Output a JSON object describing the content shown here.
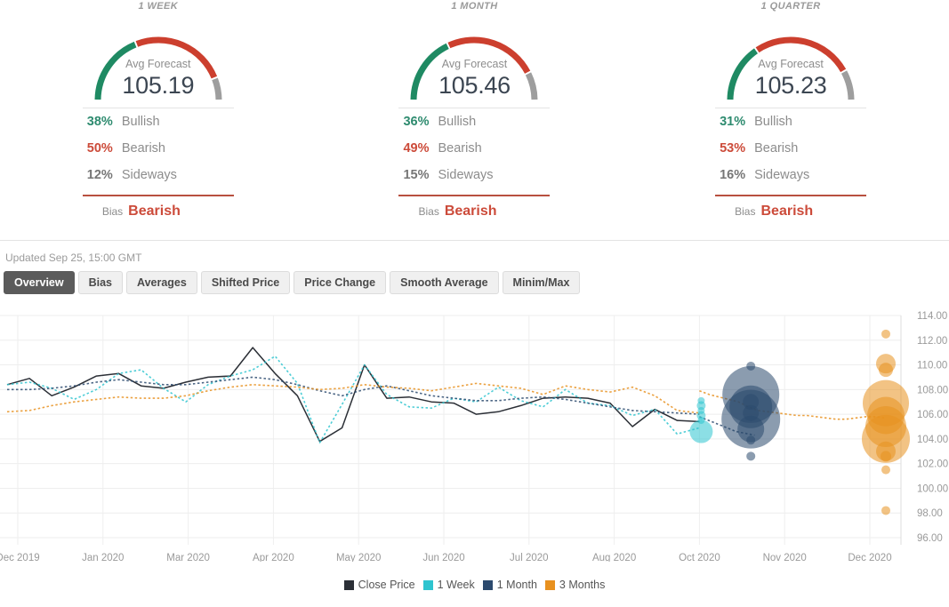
{
  "panels": [
    {
      "title": "1 WEEK",
      "gauge_label": "Avg Forecast",
      "value": "105.19",
      "bullish_pct": "38%",
      "bullish_label": "Bullish",
      "bearish_pct": "50%",
      "bearish_label": "Bearish",
      "sideways_pct": "12%",
      "sideways_label": "Sideways",
      "bias_label": "Bias",
      "bias_value": "Bearish",
      "gauge": {
        "bullish": 38,
        "bearish": 50,
        "sideways": 12
      }
    },
    {
      "title": "1 MONTH",
      "gauge_label": "Avg Forecast",
      "value": "105.46",
      "bullish_pct": "36%",
      "bullish_label": "Bullish",
      "bearish_pct": "49%",
      "bearish_label": "Bearish",
      "sideways_pct": "15%",
      "sideways_label": "Sideways",
      "bias_label": "Bias",
      "bias_value": "Bearish",
      "gauge": {
        "bullish": 36,
        "bearish": 49,
        "sideways": 15
      }
    },
    {
      "title": "1 QUARTER",
      "gauge_label": "Avg Forecast",
      "value": "105.23",
      "bullish_pct": "31%",
      "bullish_label": "Bullish",
      "bearish_pct": "53%",
      "bearish_label": "Bearish",
      "sideways_pct": "16%",
      "sideways_label": "Sideways",
      "bias_label": "Bias",
      "bias_value": "Bearish",
      "gauge": {
        "bullish": 31,
        "bearish": 53,
        "sideways": 16
      }
    }
  ],
  "updated": "Updated Sep 25, 15:00 GMT",
  "tabs": [
    {
      "label": "Overview",
      "active": true
    },
    {
      "label": "Bias",
      "active": false
    },
    {
      "label": "Averages",
      "active": false
    },
    {
      "label": "Shifted Price",
      "active": false
    },
    {
      "label": "Price Change",
      "active": false
    },
    {
      "label": "Smooth Average",
      "active": false
    },
    {
      "label": "Minim/Max",
      "active": false
    }
  ],
  "colors": {
    "bullish": "#1f8a63",
    "bearish": "#cc3f2e",
    "sideways": "#9e9e9e",
    "close_price": "#2b2f36",
    "one_week": "#2ec4cf",
    "one_month": "#2c4a6e",
    "three_months": "#e8911f",
    "grid": "#eeeeee"
  },
  "chart_data": {
    "type": "line",
    "title": "",
    "xlabel": "",
    "ylabel": "",
    "ylim": [
      96.0,
      114.0
    ],
    "y_ticks": [
      "96.00",
      "98.00",
      "100.00",
      "102.00",
      "104.00",
      "106.00",
      "108.00",
      "110.00",
      "112.00",
      "114.00"
    ],
    "x_ticks": [
      "Dec 2019",
      "Jan 2020",
      "Mar 2020",
      "Apr 2020",
      "May 2020",
      "Jun 2020",
      "Jul 2020",
      "Aug 2020",
      "Oct 2020",
      "Nov 2020",
      "Dec 2020"
    ],
    "grid": true,
    "legend_position": "bottom",
    "legend": [
      {
        "name": "Close Price",
        "color": "#2b2f36",
        "style": "solid"
      },
      {
        "name": "1 Week",
        "color": "#2ec4cf",
        "style": "dotted"
      },
      {
        "name": "1 Month",
        "color": "#2c4a6e",
        "style": "dotted"
      },
      {
        "name": "3 Months",
        "color": "#e8911f",
        "style": "dotted"
      }
    ],
    "series": [
      {
        "name": "Close Price",
        "color": "#2b2f36",
        "style": "solid",
        "values": [
          108.4,
          108.9,
          107.5,
          108.2,
          109.1,
          109.3,
          108.3,
          108.1,
          108.6,
          109.0,
          109.1,
          111.4,
          109.3,
          107.5,
          103.8,
          104.9,
          110.0,
          107.3,
          107.4,
          107.0,
          106.9,
          106.0,
          106.2,
          106.7,
          107.3,
          107.4,
          107.3,
          106.9,
          105.0,
          106.4,
          105.5,
          105.4
        ]
      },
      {
        "name": "1 Week",
        "color": "#2ec4cf",
        "style": "dotted",
        "values": [
          108.4,
          108.6,
          108.1,
          107.2,
          108.0,
          109.3,
          109.6,
          108.1,
          107.0,
          108.4,
          109.1,
          109.6,
          110.7,
          108.5,
          103.7,
          106.8,
          110.0,
          107.6,
          106.6,
          106.5,
          107.3,
          107.0,
          108.2,
          107.1,
          106.6,
          108.0,
          106.9,
          106.7,
          105.9,
          106.4,
          104.4,
          104.9
        ]
      },
      {
        "name": "1 Month",
        "color": "#2c4a6e",
        "style": "dotted",
        "values": [
          108.0,
          108.0,
          108.1,
          108.3,
          108.6,
          108.8,
          108.6,
          108.4,
          108.4,
          108.6,
          108.8,
          109.0,
          108.8,
          108.4,
          107.9,
          107.5,
          108.0,
          108.3,
          107.9,
          107.5,
          107.3,
          107.1,
          107.1,
          107.3,
          107.4,
          107.2,
          106.9,
          106.6,
          106.3,
          106.2,
          106.1,
          106.0
        ]
      },
      {
        "name": "3 Months",
        "color": "#e8911f",
        "style": "dotted",
        "values": [
          106.2,
          106.3,
          106.7,
          107.0,
          107.2,
          107.4,
          107.3,
          107.3,
          107.5,
          107.9,
          108.2,
          108.4,
          108.3,
          108.2,
          108.0,
          108.1,
          108.4,
          108.2,
          108.1,
          107.9,
          108.2,
          108.5,
          108.3,
          108.1,
          107.6,
          108.3,
          108.0,
          107.8,
          108.2,
          107.5,
          106.3,
          106.1
        ]
      }
    ],
    "forecast_tail": {
      "note": "3 Months dotted forecast continues to the right of the close-price series",
      "color": "#e8911f",
      "values": [
        107.9,
        107.6,
        107.4,
        107.2,
        107.0,
        106.6,
        106.3,
        106.2,
        106.1,
        106.0,
        105.9,
        105.9,
        105.8,
        105.7,
        105.6,
        105.6,
        105.7,
        105.8,
        105.8,
        105.7
      ]
    },
    "month_tail": {
      "note": "1 Month dotted forecast continues to the right of the close-price series",
      "color": "#2c4a6e",
      "values": [
        105.8,
        105.6,
        105.4,
        105.2,
        105.0,
        104.8,
        104.6,
        104.5,
        104.4,
        104.3
      ]
    },
    "bubbles": [
      {
        "series": "1 Week",
        "color": "#2ec4cf",
        "x_label": "Oct 2020",
        "points": [
          {
            "value": 107.1,
            "size": 4
          },
          {
            "value": 106.7,
            "size": 5
          },
          {
            "value": 106.3,
            "size": 4
          },
          {
            "value": 105.9,
            "size": 5
          },
          {
            "value": 105.5,
            "size": 4
          },
          {
            "value": 104.6,
            "size": 13
          }
        ]
      },
      {
        "series": "1 Month",
        "color": "#2c4a6e",
        "x_label": "Nov 2020",
        "points": [
          {
            "value": 109.9,
            "size": 5
          },
          {
            "value": 107.6,
            "size": 32
          },
          {
            "value": 107.0,
            "size": 9
          },
          {
            "value": 106.6,
            "size": 24
          },
          {
            "value": 106.1,
            "size": 9
          },
          {
            "value": 105.6,
            "size": 33
          },
          {
            "value": 104.8,
            "size": 15
          },
          {
            "value": 103.9,
            "size": 5
          },
          {
            "value": 102.6,
            "size": 5
          }
        ]
      },
      {
        "series": "3 Months",
        "color": "#e8911f",
        "x_label": "Dec 2020",
        "points": [
          {
            "value": 112.5,
            "size": 5
          },
          {
            "value": 110.1,
            "size": 11
          },
          {
            "value": 109.6,
            "size": 8
          },
          {
            "value": 106.9,
            "size": 26
          },
          {
            "value": 105.9,
            "size": 21
          },
          {
            "value": 105.0,
            "size": 23
          },
          {
            "value": 104.0,
            "size": 27
          },
          {
            "value": 103.0,
            "size": 11
          },
          {
            "value": 102.6,
            "size": 6
          },
          {
            "value": 101.5,
            "size": 5
          },
          {
            "value": 98.2,
            "size": 5
          }
        ]
      }
    ]
  }
}
